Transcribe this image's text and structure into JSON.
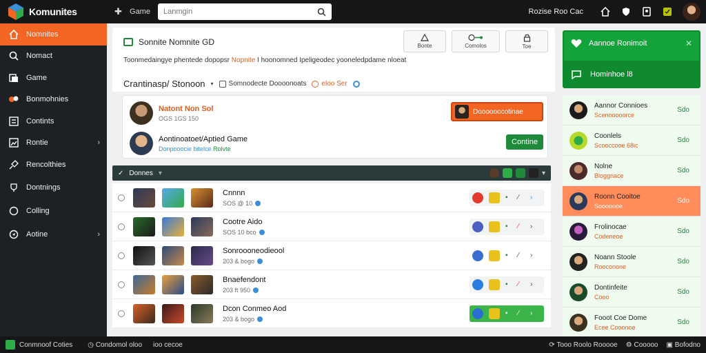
{
  "app": {
    "name": "Komunites"
  },
  "topbar": {
    "game_label": "Game",
    "search_placeholder": "Lanmgin",
    "user_label": "Rozise Roo Cac",
    "icons": [
      "home-icon",
      "shield-icon",
      "bookmark-icon",
      "badge-icon"
    ]
  },
  "sidebar": {
    "items": [
      {
        "label": "Nomnites",
        "icon": "home-icon",
        "active": true,
        "chevron": false
      },
      {
        "label": "Nomact",
        "icon": "search-icon",
        "active": false,
        "chevron": false
      },
      {
        "label": "Game",
        "icon": "controller-icon",
        "active": false,
        "chevron": false
      },
      {
        "label": "Bonmohnies",
        "icon": "group-icon",
        "active": false,
        "chevron": false
      },
      {
        "label": "Contints",
        "icon": "document-icon",
        "active": false,
        "chevron": false
      },
      {
        "label": "Rontie",
        "icon": "image-icon",
        "active": false,
        "chevron": true
      },
      {
        "label": "Rencolthies",
        "icon": "pin-icon",
        "active": false,
        "chevron": false
      },
      {
        "label": "Dontnings",
        "icon": "trophy-icon",
        "active": false,
        "chevron": false
      },
      {
        "label": "Colling",
        "icon": "chat-icon",
        "active": false,
        "chevron": false
      },
      {
        "label": "Aotine",
        "icon": "globe-icon",
        "active": false,
        "chevron": true
      }
    ]
  },
  "main": {
    "header_title": "Sonnite Nomnite GD",
    "description_pre": "Toonmedaingye phentede dopopsr ",
    "description_hl": "Nopnite",
    "description_post": " I hoonomned Ipeligeodec yooneledpdame nloeat",
    "header_buttons": [
      {
        "label": "Bonte",
        "icon": "warning-icon"
      },
      {
        "label": "Comolos",
        "icon": "toggle-icon"
      },
      {
        "label": "Toe",
        "icon": "lock-icon"
      }
    ],
    "filter_main": "Crantinasp/ Stonoon",
    "filter_item1": "Somnodecte Doooonoats",
    "filter_item2": "eloo Ser",
    "players": [
      {
        "name": "Natont Non Sol",
        "sub": "OGS 1GS 150",
        "hot": true
      },
      {
        "name": "Aontinoatoet/Aptied Game",
        "sub": "Donpooocie bitelce",
        "sub2": "Rolvte"
      }
    ],
    "orange_button_label": "Doooooocotinae",
    "green_button_label": "Contine",
    "list_header_label": "Donnes",
    "games": [
      {
        "title": "Cnnnn",
        "meta": "SOS @ 10",
        "lead_color": "#e23b2e",
        "box_style": "boxed"
      },
      {
        "title": "Cootre Aido",
        "meta": "SOS 10 bco",
        "lead_color": "#4a5fc1",
        "box_style": "boxed"
      },
      {
        "title": "Sonroooneodieool",
        "meta": "203 & bogo",
        "lead_color": "#3a6fd0",
        "box_style": "none"
      },
      {
        "title": "Bnaefendont",
        "meta": "203 ft 950",
        "lead_color": "#2a7ee0",
        "box_style": "boxed"
      },
      {
        "title": "Dcon Conmeo Aod",
        "meta": "203 & bogo",
        "lead_color": "#2a6fd0",
        "box_style": "green"
      }
    ]
  },
  "right_panel": {
    "top_title": "Aannoe Ronimoit",
    "bottom_title": "Hominhoe l8",
    "friends": [
      {
        "name": "Aannor Connioes",
        "sub": "Scenooooorce",
        "value": "Sdo",
        "hot": false
      },
      {
        "name": "Coonlels",
        "sub": "Scooccooe 68ic",
        "value": "Sdo",
        "hot": false
      },
      {
        "name": "Nolne",
        "sub": "Bloggnace",
        "value": "Sdo",
        "hot": false
      },
      {
        "name": "Roonn Cooitoe",
        "sub": "Sooooooe",
        "value": "Sdo",
        "hot": true
      },
      {
        "name": "Frolinocae",
        "sub": "Codeneoe",
        "value": "Sdo",
        "hot": false
      },
      {
        "name": "Noann Stoole",
        "sub": "Rooconone",
        "value": "Sdo",
        "hot": false
      },
      {
        "name": "Dontinfeite",
        "sub": "Cooo",
        "value": "Sdo",
        "hot": false
      },
      {
        "name": "Fooot Coe Dome",
        "sub": "Ecee Cooonoe",
        "value": "Sdo",
        "hot": false
      }
    ]
  },
  "bottombar": {
    "left_label": "Conmnoof Coties",
    "mid_item1": "Condomol oloo",
    "mid_item2": "ioo cecoe",
    "right_items": [
      "Tooo Roolo Rooooe",
      "Cooooo",
      "Bofodno"
    ]
  }
}
